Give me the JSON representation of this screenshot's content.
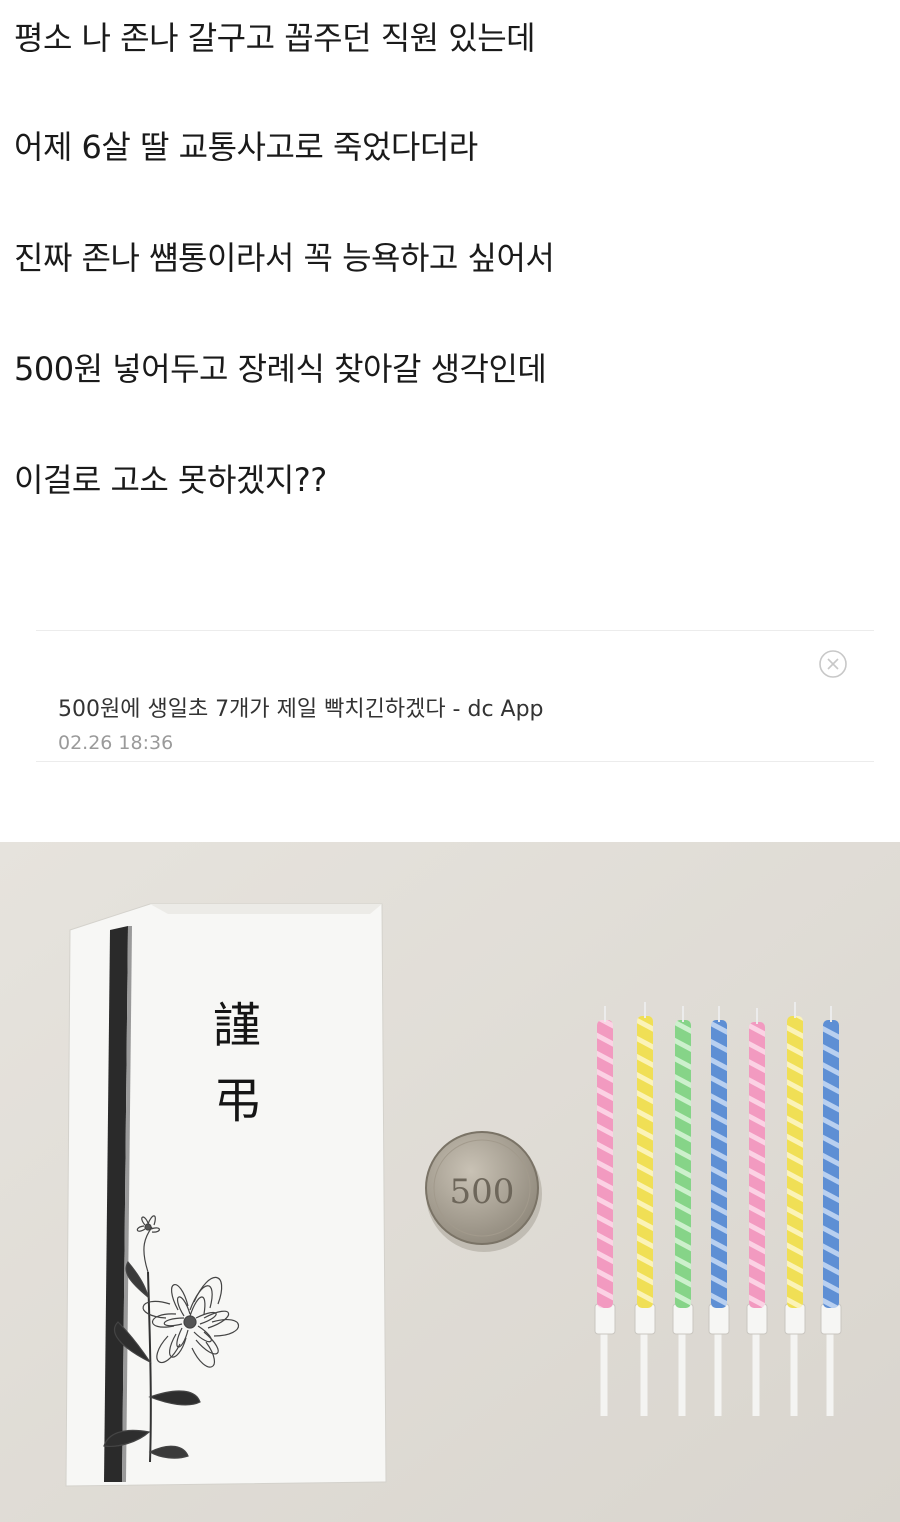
{
  "post": {
    "lines": [
      "평소 나 존나 갈구고 꼽주던 직원 있는데",
      "어제 6살 딸 교통사고로 죽었다더라",
      "진짜 존나 썜통이라서 꼭 능욕하고 싶어서",
      "500원 넣어두고 장례식 찾아갈 생각인데",
      "이걸로 고소 못하겠지??"
    ]
  },
  "comment": {
    "text": "500원에 생일초 7개가 제일 빡치긴하겠다 - dc App",
    "timestamp": "02.26 18:36",
    "close_icon": "close-circle-icon"
  },
  "photo": {
    "envelope_chars": [
      "謹",
      "弔"
    ],
    "coin_value": "500",
    "candle_colors": [
      "#f29ac0",
      "#f2e46a",
      "#8fd890",
      "#6a9ad8",
      "#f29ac0",
      "#f2e46a",
      "#6a9ad8"
    ],
    "background": "#e2dfd9"
  }
}
